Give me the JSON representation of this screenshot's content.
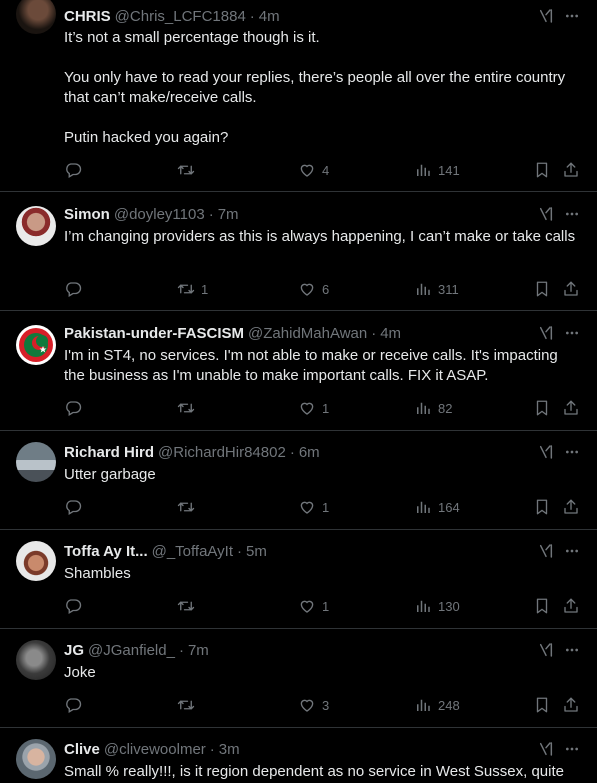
{
  "tweets": [
    {
      "name": "CHRIS",
      "handle": "@Chris_LCFC1884",
      "time": "4m",
      "paragraphs": [
        "It’s not a small percentage though is it.",
        "You only have to read your replies, there’s people all over the entire country that can’t make/receive calls.",
        "Putin hacked you again?"
      ],
      "replies": "",
      "retweets": "",
      "likes": "4",
      "views": "141"
    },
    {
      "name": "Simon",
      "handle": "@doyley1103",
      "time": "7m",
      "paragraphs": [
        "I’m changing providers as this is always happening, I can’t make or take calls"
      ],
      "replies": "",
      "retweets": "1",
      "likes": "6",
      "views": "311"
    },
    {
      "name": "Pakistan-under-FASCISM",
      "handle": "@ZahidMahAwan",
      "time": "4m",
      "paragraphs": [
        "I'm in ST4, no services. I'm not able to make or receive calls. It's impacting the business as I'm unable to make important calls. FIX it ASAP."
      ],
      "replies": "",
      "retweets": "",
      "likes": "1",
      "views": "82"
    },
    {
      "name": "Richard Hird",
      "handle": "@RichardHir84802",
      "time": "6m",
      "paragraphs": [
        "Utter garbage"
      ],
      "replies": "",
      "retweets": "",
      "likes": "1",
      "views": "164"
    },
    {
      "name": "Toffa Ay It...",
      "handle": "@_ToffaAyIt",
      "time": "5m",
      "paragraphs": [
        "Shambles"
      ],
      "replies": "",
      "retweets": "",
      "likes": "1",
      "views": "130"
    },
    {
      "name": "JG",
      "handle": "@JGanfield_",
      "time": "7m",
      "paragraphs": [
        "Joke"
      ],
      "replies": "",
      "retweets": "",
      "likes": "3",
      "views": "248"
    },
    {
      "name": "Clive",
      "handle": "@clivewoolmer",
      "time": "3m",
      "paragraphs": [
        "Small % really!!!, is it region dependent as no service in West Sussex, quite"
      ],
      "replies": "",
      "retweets": "",
      "likes": "",
      "views": ""
    }
  ],
  "separator": "·",
  "icons": {
    "reply": "reply-icon",
    "retweet": "retweet-icon",
    "like": "like-icon",
    "views": "views-icon",
    "bookmark": "bookmark-icon",
    "share": "share-icon",
    "grok": "grok-icon",
    "more": "more-icon"
  },
  "colors": {
    "background": "#000000",
    "text": "#e7e9ea",
    "muted": "#71767b",
    "divider": "#2f3336"
  }
}
